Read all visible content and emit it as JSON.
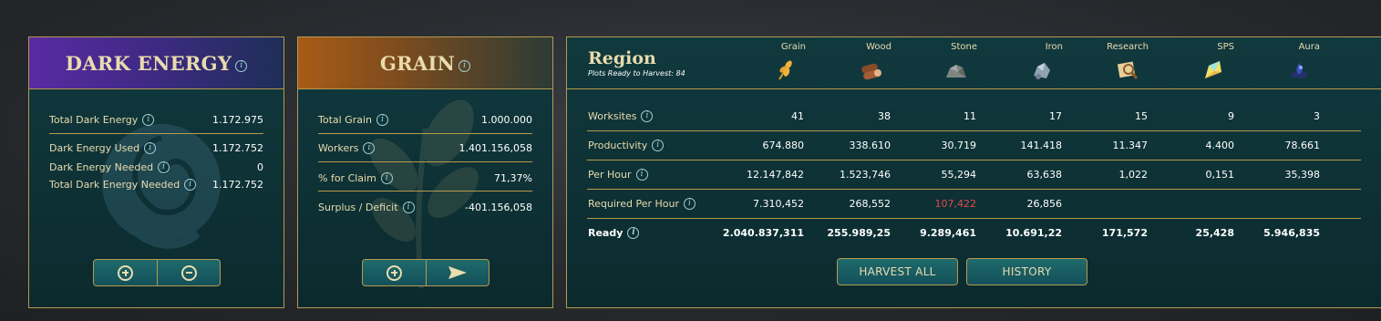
{
  "dark_energy": {
    "title": "DARK ENERGY",
    "rows": [
      {
        "label": "Total Dark Energy",
        "value": "1.172.975"
      },
      {
        "label": "Dark Energy Used",
        "value": "1.172.752"
      },
      {
        "label": "Dark Energy Needed",
        "value": "0"
      },
      {
        "label": "Total Dark Energy Needed",
        "value": "1.172.752"
      }
    ]
  },
  "grain": {
    "title": "GRAIN",
    "rows": [
      {
        "label": "Total Grain",
        "value": "1.000.000"
      },
      {
        "label": "Workers",
        "value": "1.401.156,058"
      },
      {
        "label": "% for Claim",
        "value": "71,37%"
      },
      {
        "label": "Surplus / Deficit",
        "value": "-401.156,058"
      }
    ]
  },
  "region": {
    "title": "Region",
    "subtitle": "Plots Ready to Harvest: 84",
    "columns": [
      {
        "name": "Grain",
        "icon": "grain-icon"
      },
      {
        "name": "Wood",
        "icon": "wood-icon"
      },
      {
        "name": "Stone",
        "icon": "stone-icon"
      },
      {
        "name": "Iron",
        "icon": "iron-icon"
      },
      {
        "name": "Research",
        "icon": "research-icon"
      },
      {
        "name": "SPS",
        "icon": "sps-icon"
      },
      {
        "name": "Aura",
        "icon": "aura-icon"
      }
    ],
    "rows": [
      {
        "label": "Worksites",
        "values": [
          "41",
          "38",
          "11",
          "17",
          "15",
          "9",
          "3"
        ]
      },
      {
        "label": "Productivity",
        "values": [
          "674.880",
          "338.610",
          "30.719",
          "141.418",
          "11.347",
          "4.400",
          "78.661"
        ]
      },
      {
        "label": "Per Hour",
        "values": [
          "12.147,842",
          "1.523,746",
          "55,294",
          "63,638",
          "1,022",
          "0,151",
          "35,398"
        ]
      },
      {
        "label": "Required Per Hour",
        "values": [
          "7.310,452",
          "268,552",
          "107,422",
          "26,856",
          "",
          "",
          ""
        ]
      },
      {
        "label": "Ready",
        "values": [
          "2.040.837,311",
          "255.989,25",
          "9.289,461",
          "10.691,22",
          "171,572",
          "25,428",
          "5.946,835"
        ]
      }
    ],
    "harvest_label": "HARVEST ALL",
    "history_label": "HISTORY"
  },
  "colors": {
    "accent_gold": "#b69a4e",
    "label_cream": "#e9dcae",
    "warning_red": "#e0494a"
  }
}
